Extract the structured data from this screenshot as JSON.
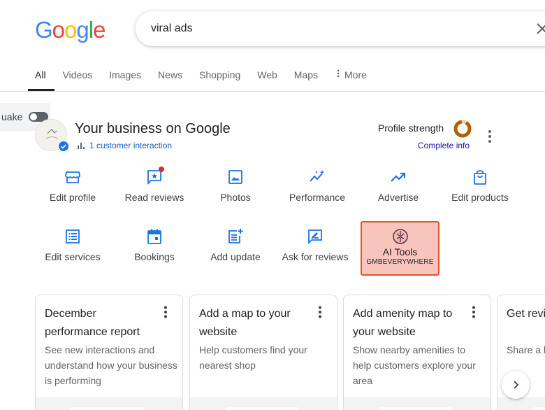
{
  "search": {
    "query": "viral ads"
  },
  "logo": {
    "letters": [
      "G",
      "o",
      "o",
      "g",
      "l",
      "e"
    ],
    "colors": [
      "#4285F4",
      "#EA4335",
      "#FBBC05",
      "#4285F4",
      "#34A853",
      "#EA4335"
    ]
  },
  "tabs": [
    {
      "label": "All",
      "active": true
    },
    {
      "label": "Videos"
    },
    {
      "label": "Images"
    },
    {
      "label": "News"
    },
    {
      "label": "Shopping"
    },
    {
      "label": "Web"
    },
    {
      "label": "Maps"
    },
    {
      "label": "More"
    }
  ],
  "side_widget": {
    "label": "uake"
  },
  "business": {
    "title": "Your business on Google",
    "interaction": "1 customer interaction",
    "profile_strength_label": "Profile strength",
    "complete_info": "Complete info"
  },
  "actions_row1": [
    {
      "label": "Edit profile",
      "icon": "store-icon"
    },
    {
      "label": "Read reviews",
      "icon": "reviews-icon"
    },
    {
      "label": "Photos",
      "icon": "photos-icon"
    },
    {
      "label": "Performance",
      "icon": "performance-icon"
    },
    {
      "label": "Advertise",
      "icon": "trending-up-icon"
    },
    {
      "label": "Edit products",
      "icon": "shopping-bag-icon"
    }
  ],
  "actions_row2": [
    {
      "label": "Edit services",
      "icon": "list-icon"
    },
    {
      "label": "Bookings",
      "icon": "calendar-icon"
    },
    {
      "label": "Add update",
      "icon": "post-add-icon"
    },
    {
      "label": "Ask for reviews",
      "icon": "rate-review-icon"
    }
  ],
  "ai_tools": {
    "title": "AI Tools",
    "subtitle": "GMBEVERYWHERE",
    "icon": "brain-icon"
  },
  "cards": [
    {
      "title": "December performance report",
      "desc": "See new interactions and understand how your business is performing"
    },
    {
      "title": "Add a map to your website",
      "desc": "Help customers find your nearest shop"
    },
    {
      "title": "Add amenity map to your website",
      "desc": "Show nearby amenities to help customers explore your area"
    },
    {
      "title": "Get reviews from customers",
      "desc": "Share a link with customers"
    }
  ],
  "colors": {
    "accent_blue": "#1a73e8",
    "donut_orange": "#b06000",
    "ai_border": "#e0552f",
    "ai_bg": "#f8c5bc"
  }
}
